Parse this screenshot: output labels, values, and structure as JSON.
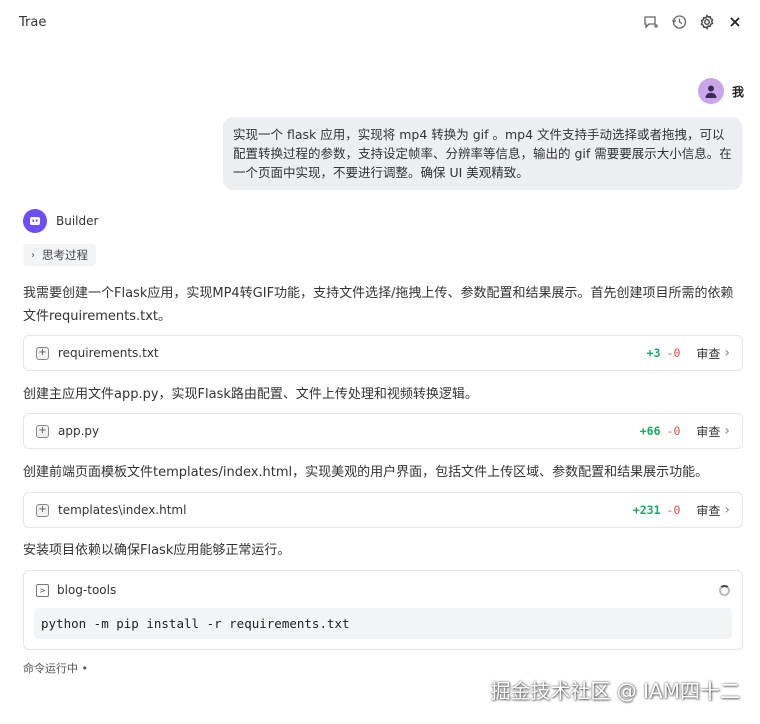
{
  "app": {
    "title": "Trae"
  },
  "header_icons": [
    "chat-add-icon",
    "history-icon",
    "settings-icon",
    "close-icon"
  ],
  "user": {
    "name": "我"
  },
  "user_message": "实现一个 flask 应用，实现将 mp4 转换为 gif 。mp4 文件支持手动选择或者拖拽，可以配置转换过程的参数，支持设定帧率、分辨率等信息，输出的 gif 需要要展示大小信息。在一个页面中实现，不要进行调整。确保 UI 美观精致。",
  "assistant": {
    "name": "Builder",
    "thinking_label": "思考过程"
  },
  "steps": [
    {
      "text": "我需要创建一个Flask应用，实现MP4转GIF功能，支持文件选择/拖拽上传、参数配置和结果展示。首先创建项目所需的依赖文件requirements.txt。",
      "file": "requirements.txt",
      "add": "+3",
      "del": "-0",
      "review": "审查"
    },
    {
      "text": "创建主应用文件app.py，实现Flask路由配置、文件上传处理和视频转换逻辑。",
      "file": "app.py",
      "add": "+66",
      "del": "-0",
      "review": "审查"
    },
    {
      "text": "创建前端页面模板文件templates/index.html，实现美观的用户界面，包括文件上传区域、参数配置和结果展示功能。",
      "file": "templates\\index.html",
      "add": "+231",
      "del": "-0",
      "review": "审查"
    }
  ],
  "install_text": "安装项目依赖以确保Flask应用能够正常运行。",
  "terminal": {
    "name": "blog-tools",
    "command": "python -m pip install -r requirements.txt"
  },
  "status": "命令运行中 •",
  "watermark": "掘金技术社区 @ IAM四十二"
}
